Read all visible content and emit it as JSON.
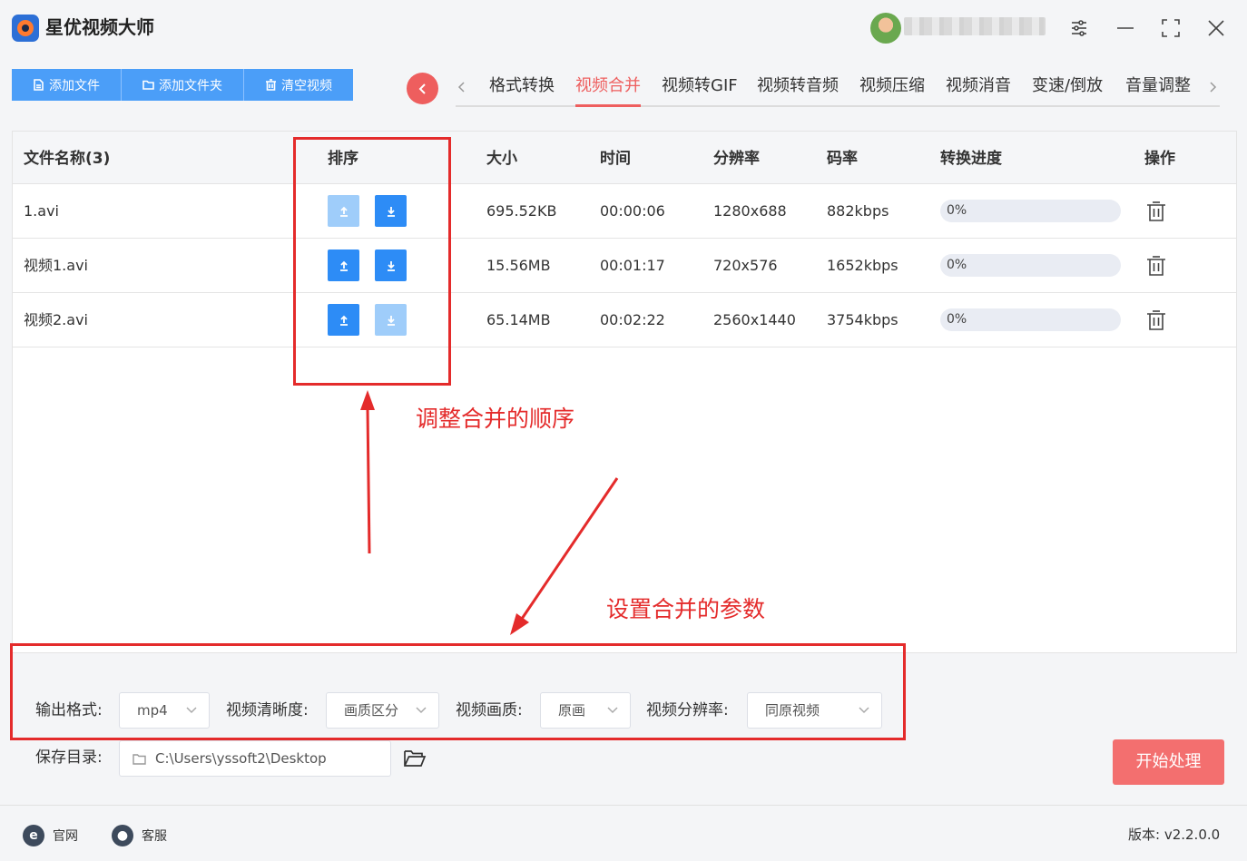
{
  "app": {
    "title": "星优视频大师",
    "user_name": ""
  },
  "window_controls": [
    "settings-icon",
    "minimize-icon",
    "maximize-icon",
    "close-icon"
  ],
  "toolbar": {
    "add_file": "添加文件",
    "add_folder": "添加文件夹",
    "clear_videos": "清空视频"
  },
  "tabs": [
    {
      "label": "格式转换",
      "active": false
    },
    {
      "label": "视频合并",
      "active": true
    },
    {
      "label": "视频转GIF",
      "active": false
    },
    {
      "label": "视频转音频",
      "active": false
    },
    {
      "label": "视频压缩",
      "active": false
    },
    {
      "label": "视频消音",
      "active": false
    },
    {
      "label": "变速/倒放",
      "active": false
    },
    {
      "label": "音量调整",
      "active": false
    }
  ],
  "table": {
    "headers": {
      "name": "文件名称(3)",
      "order": "排序",
      "size": "大小",
      "time": "时间",
      "resolution": "分辨率",
      "bitrate": "码率",
      "progress": "转换进度",
      "action": "操作"
    },
    "rows": [
      {
        "name": "1.avi",
        "size": "695.52KB",
        "time": "00:00:06",
        "resolution": "1280x688",
        "bitrate": "882kbps",
        "progress": 0,
        "progress_label": "0%",
        "up_enabled": false,
        "down_enabled": true
      },
      {
        "name": "视频1.avi",
        "size": "15.56MB",
        "time": "00:01:17",
        "resolution": "720x576",
        "bitrate": "1652kbps",
        "progress": 0,
        "progress_label": "0%",
        "up_enabled": true,
        "down_enabled": true
      },
      {
        "name": "视频2.avi",
        "size": "65.14MB",
        "time": "00:02:22",
        "resolution": "2560x1440",
        "bitrate": "3754kbps",
        "progress": 0,
        "progress_label": "0%",
        "up_enabled": true,
        "down_enabled": false
      }
    ]
  },
  "annotations": {
    "order": "调整合并的顺序",
    "params": "设置合并的参数",
    "color": "#e42b2b"
  },
  "settings": {
    "output_format_label": "输出格式:",
    "output_format_value": "mp4",
    "clarity_label": "视频清晰度:",
    "clarity_value": "画质区分",
    "quality_label": "视频画质:",
    "quality_value": "原画",
    "resolution_label": "视频分辨率:",
    "resolution_value": "同原视频",
    "save_dir_label": "保存目录:",
    "save_dir_value": "C:\\Users\\yssoft2\\Desktop",
    "start_button": "开始处理"
  },
  "footer": {
    "website": "官网",
    "support": "客服",
    "version": "版本: v2.2.0.0"
  },
  "colors": {
    "accent_blue": "#4b9ef8",
    "sort_blue": "#2d8cf6",
    "accent_red": "#ee5e5e",
    "start_red": "#f36f6f"
  }
}
